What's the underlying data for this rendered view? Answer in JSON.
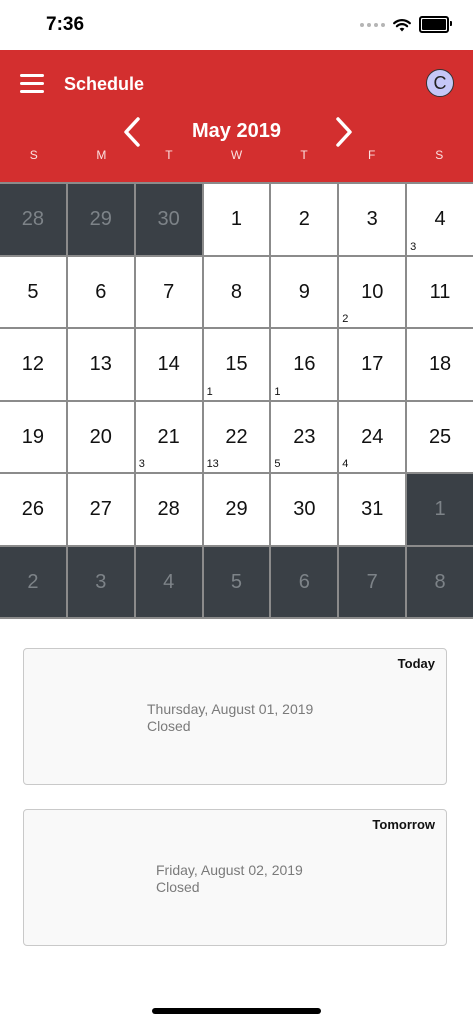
{
  "status_bar": {
    "time": "7:36"
  },
  "header": {
    "title": "Schedule",
    "avatar_letter": "C",
    "month_label": "May 2019",
    "weekdays": [
      "S",
      "M",
      "T",
      "W",
      "T",
      "F",
      "S"
    ]
  },
  "calendar": {
    "weeks": [
      [
        {
          "day": "28",
          "other": true,
          "count": ""
        },
        {
          "day": "29",
          "other": true,
          "count": ""
        },
        {
          "day": "30",
          "other": true,
          "count": ""
        },
        {
          "day": "1",
          "other": false,
          "count": ""
        },
        {
          "day": "2",
          "other": false,
          "count": ""
        },
        {
          "day": "3",
          "other": false,
          "count": ""
        },
        {
          "day": "4",
          "other": false,
          "count": "3"
        }
      ],
      [
        {
          "day": "5",
          "other": false,
          "count": ""
        },
        {
          "day": "6",
          "other": false,
          "count": ""
        },
        {
          "day": "7",
          "other": false,
          "count": ""
        },
        {
          "day": "8",
          "other": false,
          "count": ""
        },
        {
          "day": "9",
          "other": false,
          "count": ""
        },
        {
          "day": "10",
          "other": false,
          "count": "2"
        },
        {
          "day": "11",
          "other": false,
          "count": ""
        }
      ],
      [
        {
          "day": "12",
          "other": false,
          "count": ""
        },
        {
          "day": "13",
          "other": false,
          "count": ""
        },
        {
          "day": "14",
          "other": false,
          "count": ""
        },
        {
          "day": "15",
          "other": false,
          "count": "1"
        },
        {
          "day": "16",
          "other": false,
          "count": "1"
        },
        {
          "day": "17",
          "other": false,
          "count": ""
        },
        {
          "day": "18",
          "other": false,
          "count": ""
        }
      ],
      [
        {
          "day": "19",
          "other": false,
          "count": ""
        },
        {
          "day": "20",
          "other": false,
          "count": ""
        },
        {
          "day": "21",
          "other": false,
          "count": "3"
        },
        {
          "day": "22",
          "other": false,
          "count": "13"
        },
        {
          "day": "23",
          "other": false,
          "count": "5"
        },
        {
          "day": "24",
          "other": false,
          "count": "4"
        },
        {
          "day": "25",
          "other": false,
          "count": ""
        }
      ],
      [
        {
          "day": "26",
          "other": false,
          "count": ""
        },
        {
          "day": "27",
          "other": false,
          "count": ""
        },
        {
          "day": "28",
          "other": false,
          "count": ""
        },
        {
          "day": "29",
          "other": false,
          "count": ""
        },
        {
          "day": "30",
          "other": false,
          "count": ""
        },
        {
          "day": "31",
          "other": false,
          "count": ""
        },
        {
          "day": "1",
          "other": true,
          "count": ""
        }
      ],
      [
        {
          "day": "2",
          "other": true,
          "count": ""
        },
        {
          "day": "3",
          "other": true,
          "count": ""
        },
        {
          "day": "4",
          "other": true,
          "count": ""
        },
        {
          "day": "5",
          "other": true,
          "count": ""
        },
        {
          "day": "6",
          "other": true,
          "count": ""
        },
        {
          "day": "7",
          "other": true,
          "count": ""
        },
        {
          "day": "8",
          "other": true,
          "count": ""
        }
      ]
    ]
  },
  "cards": [
    {
      "tag": "Today",
      "date": "Thursday, August 01, 2019",
      "status": "Closed"
    },
    {
      "tag": "Tomorrow",
      "date": "Friday, August 02, 2019",
      "status": "Closed"
    }
  ],
  "colors": {
    "header_red": "#d32f2f",
    "outside_month_cell": "#3a4046",
    "avatar_purple": "#c5c7f7"
  }
}
